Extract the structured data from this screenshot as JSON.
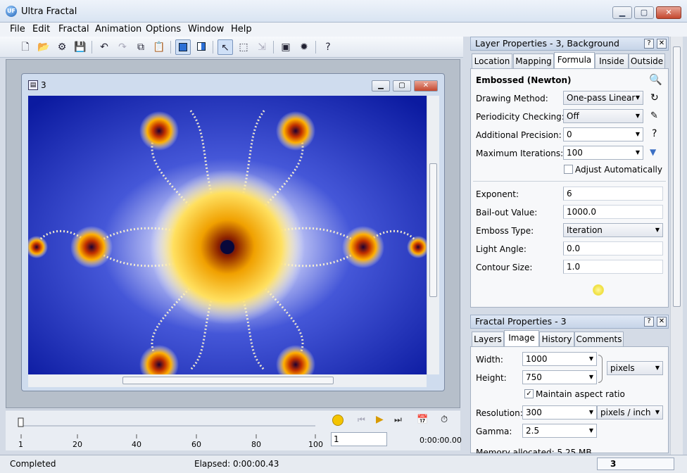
{
  "app": {
    "title": "Ultra Fractal",
    "icon_text": "UF"
  },
  "menu": [
    "File",
    "Edit",
    "Fractal",
    "Animation",
    "Options",
    "Window",
    "Help"
  ],
  "toolbar": {
    "help_label": "?"
  },
  "document": {
    "title": "3"
  },
  "timeline": {
    "tick_labels": [
      "1",
      "20",
      "40",
      "60",
      "80",
      "100"
    ],
    "frame_value": "1",
    "time": "0:00:00.00"
  },
  "status": {
    "state": "Completed",
    "elapsed": "Elapsed: 0:00:00.43",
    "window_name": "3"
  },
  "layer_panel": {
    "title": "Layer Properties - 3, Background",
    "tabs": [
      "Location",
      "Mapping",
      "Formula",
      "Inside",
      "Outside"
    ],
    "active_tab": "Formula",
    "formula_name": "Embossed (Newton)",
    "fields": {
      "drawing_method": {
        "label": "Drawing Method:",
        "value": "One-pass Linear"
      },
      "periodicity": {
        "label": "Periodicity Checking:",
        "value": "Off"
      },
      "precision": {
        "label": "Additional Precision:",
        "value": "0"
      },
      "max_iter": {
        "label": "Maximum Iterations:",
        "value": "100"
      },
      "adjust": {
        "label": "Adjust Automatically"
      },
      "exponent": {
        "label": "Exponent:",
        "value": "6"
      },
      "bailout": {
        "label": "Bail-out Value:",
        "value": "1000.0"
      },
      "emboss": {
        "label": "Emboss Type:",
        "value": "Iteration"
      },
      "light": {
        "label": "Light Angle:",
        "value": "0.0"
      },
      "contour": {
        "label": "Contour Size:",
        "value": "1.0"
      }
    },
    "help_glyph": "?"
  },
  "fractal_panel": {
    "title": "Fractal Properties - 3",
    "tabs": [
      "Layers",
      "Image",
      "History",
      "Comments"
    ],
    "active_tab": "Image",
    "width": {
      "label": "Width:",
      "value": "1000"
    },
    "height": {
      "label": "Height:",
      "value": "750"
    },
    "units": "pixels",
    "maintain": "Maintain aspect ratio",
    "resolution": {
      "label": "Resolution:",
      "value": "300",
      "units": "pixels / inch"
    },
    "gamma": {
      "label": "Gamma:",
      "value": "2.5"
    },
    "memory": "Memory allocated:  5.25 MB"
  }
}
